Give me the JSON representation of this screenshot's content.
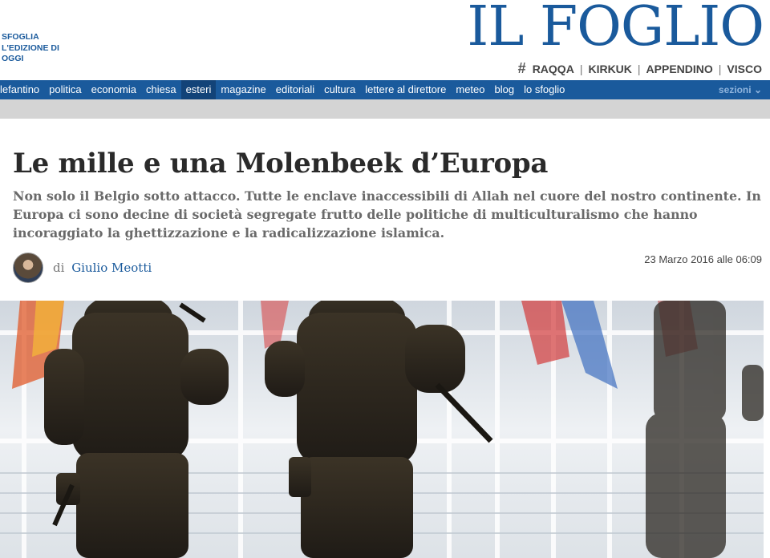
{
  "header": {
    "sfoglia_label": "SFOGLIA L'EDIZIONE DI OGGI",
    "logo": "IL FOGLIO",
    "hashtag_icon": "hash-icon",
    "tags": [
      "RAQQA",
      "KIRKUK",
      "APPENDINO",
      "VISCO"
    ]
  },
  "nav": {
    "items": [
      "lefantino",
      "politica",
      "economia",
      "chiesa",
      "esteri",
      "magazine",
      "editoriali",
      "cultura",
      "lettere al direttore",
      "meteo",
      "blog",
      "lo sfoglio"
    ],
    "active": "esteri",
    "sezioni_label": "sezioni",
    "sezioni_icon": "chevron-down-icon"
  },
  "article": {
    "headline": "Le mille e una Molenbeek d’Europa",
    "summary": "Non solo il Belgio sotto attacco. Tutte le enclave inaccessibili di Allah nel cuore del nostro continente. In Europa ci sono decine di società segregate frutto delle politiche di multiculturalismo che hanno incoraggiato la ghettizzazione e la radicalizzazione islamica.",
    "byline_prefix": "di",
    "author": "Giulio Meotti",
    "date": "23 Marzo 2016 alle 06:09"
  },
  "colors": {
    "brand": "#1a5a9c",
    "nav_active": "#124378"
  }
}
